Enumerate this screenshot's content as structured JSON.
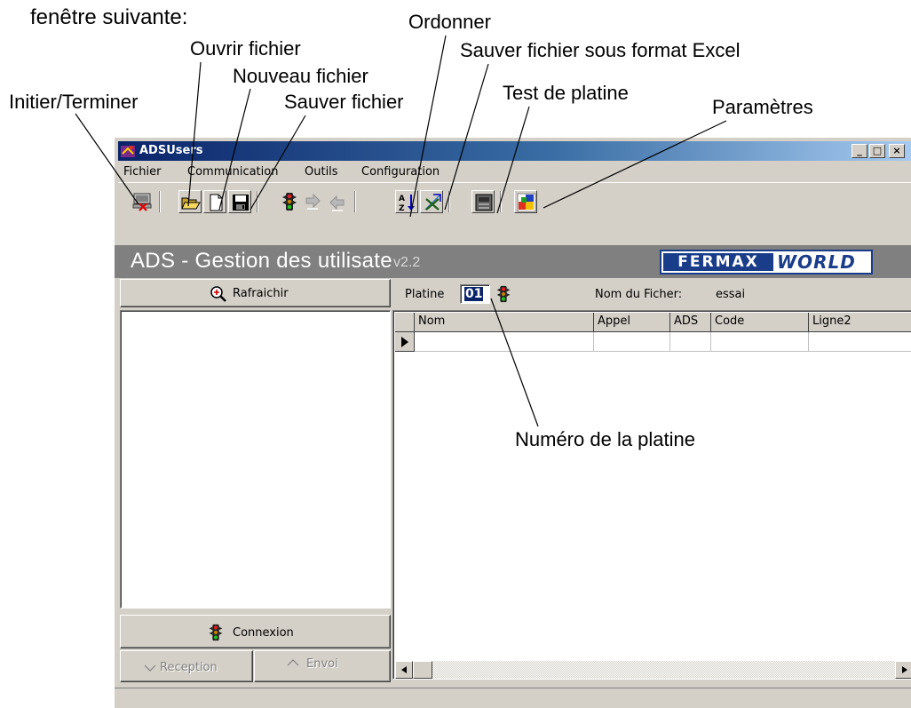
{
  "intro_text": "fenêtre suivante:",
  "callouts": {
    "initier": "Initier/Terminer",
    "ouvrir": "Ouvrir fichier",
    "nouveau": "Nouveau fichier",
    "sauver": "Sauver fichier",
    "ordonner": "Ordonner",
    "excel": "Sauver fichier sous format Excel",
    "test": "Test de platine",
    "parametres": "Paramètres",
    "numero": "Numéro de la platine"
  },
  "window": {
    "title": "ADSUsers",
    "minimize": "_",
    "maximize": "□",
    "close": "×"
  },
  "menu": [
    {
      "label": "Fichier"
    },
    {
      "label": "Communication"
    },
    {
      "label": "Outils"
    },
    {
      "label": "Configuration"
    }
  ],
  "toolbar": {
    "icons": [
      "initiate-terminate-icon",
      "open-folder-icon",
      "new-file-icon",
      "save-disk-icon",
      "traffic-light-icon",
      "receive-arrow-icon",
      "send-arrow-icon",
      "sort-az-icon",
      "excel-export-icon",
      "panel-test-icon",
      "parameters-icon"
    ]
  },
  "banner": {
    "title": "ADS - Gestion des utilisateurs",
    "version": "v2.2",
    "logo_left": "FERMAX",
    "logo_right": "WORLD"
  },
  "left_panel": {
    "refresh_label": "Rafraichir",
    "connect_label": "Connexion",
    "reception_label": "Reception",
    "envoi_label": "Envoi"
  },
  "right_panel": {
    "platine_label": "Platine",
    "platine_value": "01",
    "file_label": "Nom du Ficher:",
    "file_value": "essai",
    "columns": [
      "Nom",
      "Appel",
      "ADS",
      "Code",
      "Ligne2"
    ]
  },
  "colors": {
    "title_gradient_start": "#0a246a",
    "title_gradient_end": "#a6caf0",
    "face": "#d4d0c8",
    "banner": "#808080",
    "fermax_blue": "#1a3d8a"
  }
}
